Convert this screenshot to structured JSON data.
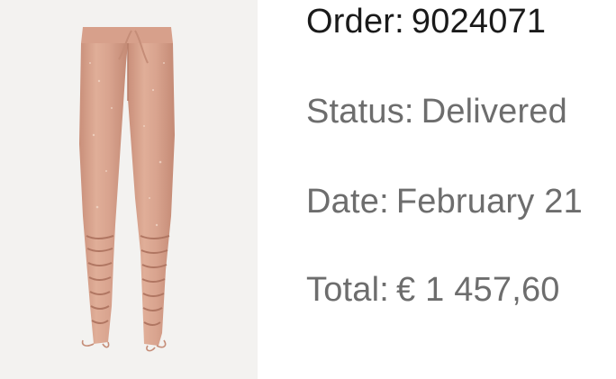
{
  "product": {
    "image_icon": "sequin-track-pants-image"
  },
  "order": {
    "label": "Order:",
    "value": "9024071"
  },
  "status": {
    "label": "Status:",
    "value": "Delivered"
  },
  "date": {
    "label": "Date:",
    "value": "February 21"
  },
  "total": {
    "label": "Total:",
    "value": "€ 1 457,60"
  },
  "colors": {
    "thumb_background": "#f3f2f0",
    "garment": "#d9a48f",
    "primary_text": "#1a1a1a",
    "secondary_text": "#6d6d6d"
  }
}
